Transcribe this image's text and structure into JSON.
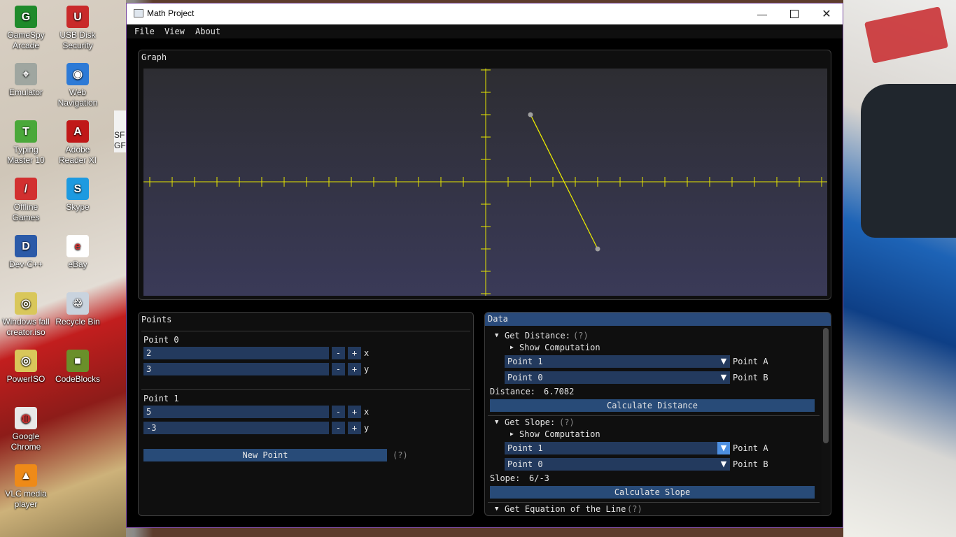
{
  "desktop": {
    "icons": [
      {
        "label": "GameSpy Arcade",
        "color": "#1f8a2b",
        "glyph": "G"
      },
      {
        "label": "USB Disk Security",
        "color": "#c92a2a",
        "glyph": "U"
      },
      {
        "label": "Emulator",
        "color": "#9fa6a0",
        "glyph": "⌖"
      },
      {
        "label": "Web Navigation",
        "color": "#2d7ad6",
        "glyph": "◉"
      },
      {
        "label": "Typing Master 10",
        "color": "#4aa83a",
        "glyph": "T"
      },
      {
        "label": "Adobe Reader XI",
        "color": "#c01818",
        "glyph": "A"
      },
      {
        "label": "Offline Games",
        "color": "#d23030",
        "glyph": "/"
      },
      {
        "label": "Skype",
        "color": "#1d9ae0",
        "glyph": "S"
      },
      {
        "label": "Dev-C++",
        "color": "#2b5aa8",
        "glyph": "D"
      },
      {
        "label": "eBay",
        "color": "#ffffff",
        "glyph": "e"
      },
      {
        "label": "Windows fall creator.iso",
        "color": "#d9c75a",
        "glyph": "◎"
      },
      {
        "label": "Recycle Bin",
        "color": "#c9d3de",
        "glyph": "♲"
      },
      {
        "label": "PowerISO",
        "color": "#d9c75a",
        "glyph": "◎"
      },
      {
        "label": "CodeBlocks",
        "color": "#6a8f2a",
        "glyph": "■"
      },
      {
        "label": "Google Chrome",
        "color": "#e8e8e8",
        "glyph": "◍"
      },
      {
        "label": "VLC media player",
        "color": "#ee8a18",
        "glyph": "▲"
      }
    ],
    "partial_text": "SF GF"
  },
  "window": {
    "title": "Math Project",
    "menu": [
      "File",
      "View",
      "About"
    ]
  },
  "graph": {
    "title": "Graph"
  },
  "chart_data": {
    "type": "line",
    "title": "Graph",
    "xlabel": "",
    "ylabel": "",
    "xlim": [
      -15,
      15
    ],
    "ylim": [
      -5,
      5
    ],
    "series": [
      {
        "values": [
          {
            "x": 2,
            "y": 3
          },
          {
            "x": 5,
            "y": -3
          }
        ]
      }
    ],
    "color": "#e6e600",
    "point_color": "#a0a0a0"
  },
  "points_panel": {
    "title": "Points",
    "points": [
      {
        "label": "Point 0",
        "x": "2",
        "y": "3"
      },
      {
        "label": "Point 1",
        "x": "5",
        "y": "-3"
      }
    ],
    "x_label": "x",
    "y_label": "y",
    "minus": "-",
    "plus": "+",
    "new_point": "New Point",
    "help": "(?)"
  },
  "data_panel": {
    "title": "Data",
    "distance": {
      "header": "Get Distance:",
      "help": "(?)",
      "show_comp": "Show Computation",
      "point_a": "Point 1",
      "point_b": "Point 0",
      "label_a": "Point A",
      "label_b": "Point B",
      "result_label": "Distance:",
      "result_value": "6.7082",
      "button": "Calculate Distance"
    },
    "slope": {
      "header": "Get Slope:",
      "help": "(?)",
      "show_comp": "Show Computation",
      "point_a": "Point 1",
      "point_b": "Point 0",
      "label_a": "Point A",
      "label_b": "Point B",
      "result_label": "Slope:",
      "result_value": "6/-3",
      "button": "Calculate Slope"
    },
    "equation": {
      "header": "Get Equation of the Line",
      "help": "(?)"
    }
  }
}
